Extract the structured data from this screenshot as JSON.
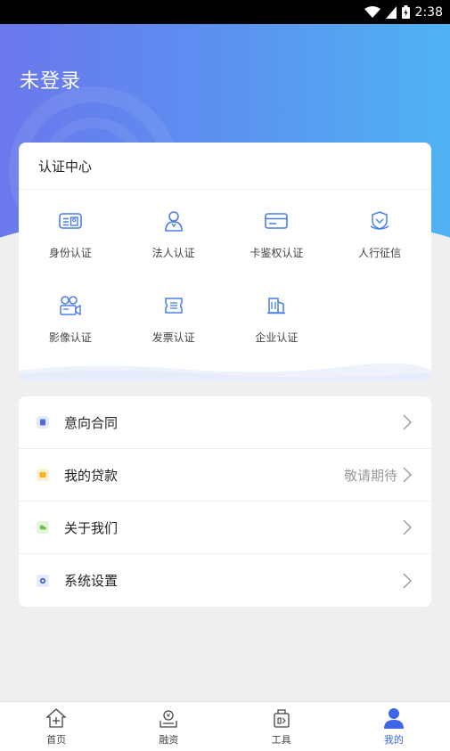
{
  "status_bar": {
    "time": "2:38"
  },
  "header": {
    "title": "未登录"
  },
  "certification": {
    "title": "认证中心",
    "items": [
      {
        "label": "身份认证",
        "icon": "id-card-icon"
      },
      {
        "label": "法人认证",
        "icon": "person-icon"
      },
      {
        "label": "卡鉴权认证",
        "icon": "bank-card-icon"
      },
      {
        "label": "人行征信",
        "icon": "credit-shield-icon"
      },
      {
        "label": "影像认证",
        "icon": "video-camera-icon"
      },
      {
        "label": "发票认证",
        "icon": "invoice-icon"
      },
      {
        "label": "企业认证",
        "icon": "building-icon"
      }
    ]
  },
  "menu": {
    "items": [
      {
        "label": "意向合同",
        "right": "",
        "icon": "contract-icon",
        "color": "#4a6ee8"
      },
      {
        "label": "我的贷款",
        "right": "敬请期待",
        "icon": "loan-icon",
        "color": "#f2b325"
      },
      {
        "label": "关于我们",
        "right": "",
        "icon": "about-icon",
        "color": "#6cc04a"
      },
      {
        "label": "系统设置",
        "right": "",
        "icon": "settings-icon",
        "color": "#4a6ee8"
      }
    ]
  },
  "bottom_nav": {
    "items": [
      {
        "label": "首页",
        "icon": "home-icon"
      },
      {
        "label": "融资",
        "icon": "finance-icon"
      },
      {
        "label": "工具",
        "icon": "tools-icon"
      },
      {
        "label": "我的",
        "icon": "profile-icon"
      }
    ],
    "active_color": "#3e66e6"
  },
  "colors": {
    "accent": "#3e66e6",
    "icon_blue": "#4a7ee8"
  }
}
